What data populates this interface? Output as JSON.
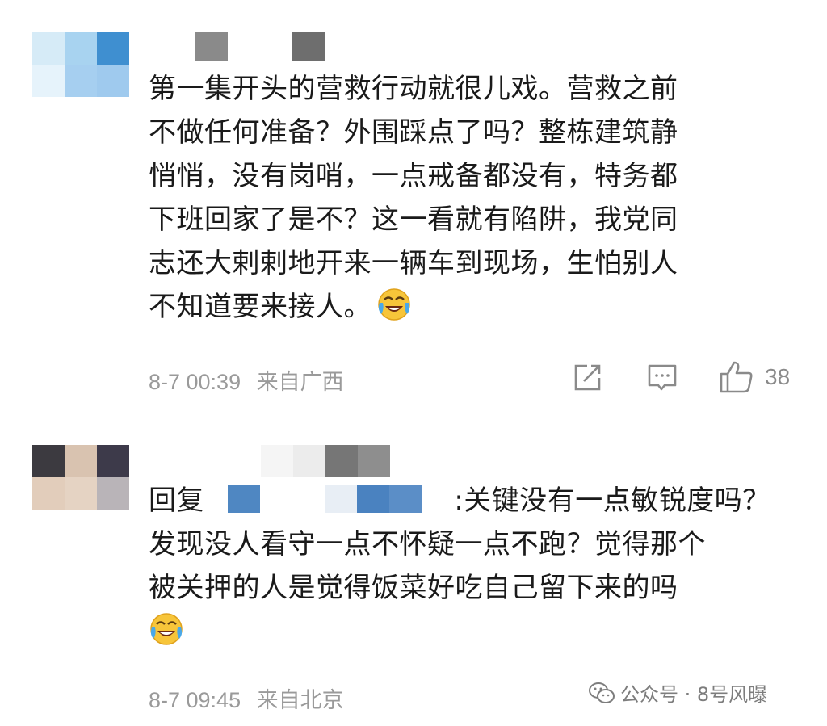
{
  "comments": [
    {
      "text_lines": [
        "第一集开头的营救行动就很儿戏。营救之前",
        "不做任何准备？外围踩点了吗？整栋建筑静",
        "悄悄，没有岗哨，一点戒备都没有，特务都",
        "下班回家了是不？这一看就有陷阱，我党同",
        "志还大剌剌地开来一辆车到现场，生怕别人",
        "不知道要来接人。"
      ],
      "emoji_icon": "laughing-crying-face-icon",
      "date": "8-7 00:39",
      "location": "来自广西",
      "likes": "38",
      "actions": [
        "share-icon",
        "comment-icon",
        "like-icon"
      ]
    },
    {
      "reply_prefix": "回复",
      "reply_rest": ":关键没有一点敏锐度吗？",
      "text_lines": [
        "发现没人看守一点不怀疑一点不跑？觉得那个",
        "被关押的人是觉得饭菜好吃自己留下来的吗"
      ],
      "emoji_icon": "laughing-crying-face-icon",
      "date": "8-7 09:45",
      "location": "来自北京"
    }
  ],
  "watermark": {
    "text": "公众号 · 8号风曝",
    "icon": "wechat-icon"
  },
  "colors": {
    "text": "#1a1a1a",
    "meta": "#9a9a9a",
    "icon": "#8a8a8a"
  }
}
